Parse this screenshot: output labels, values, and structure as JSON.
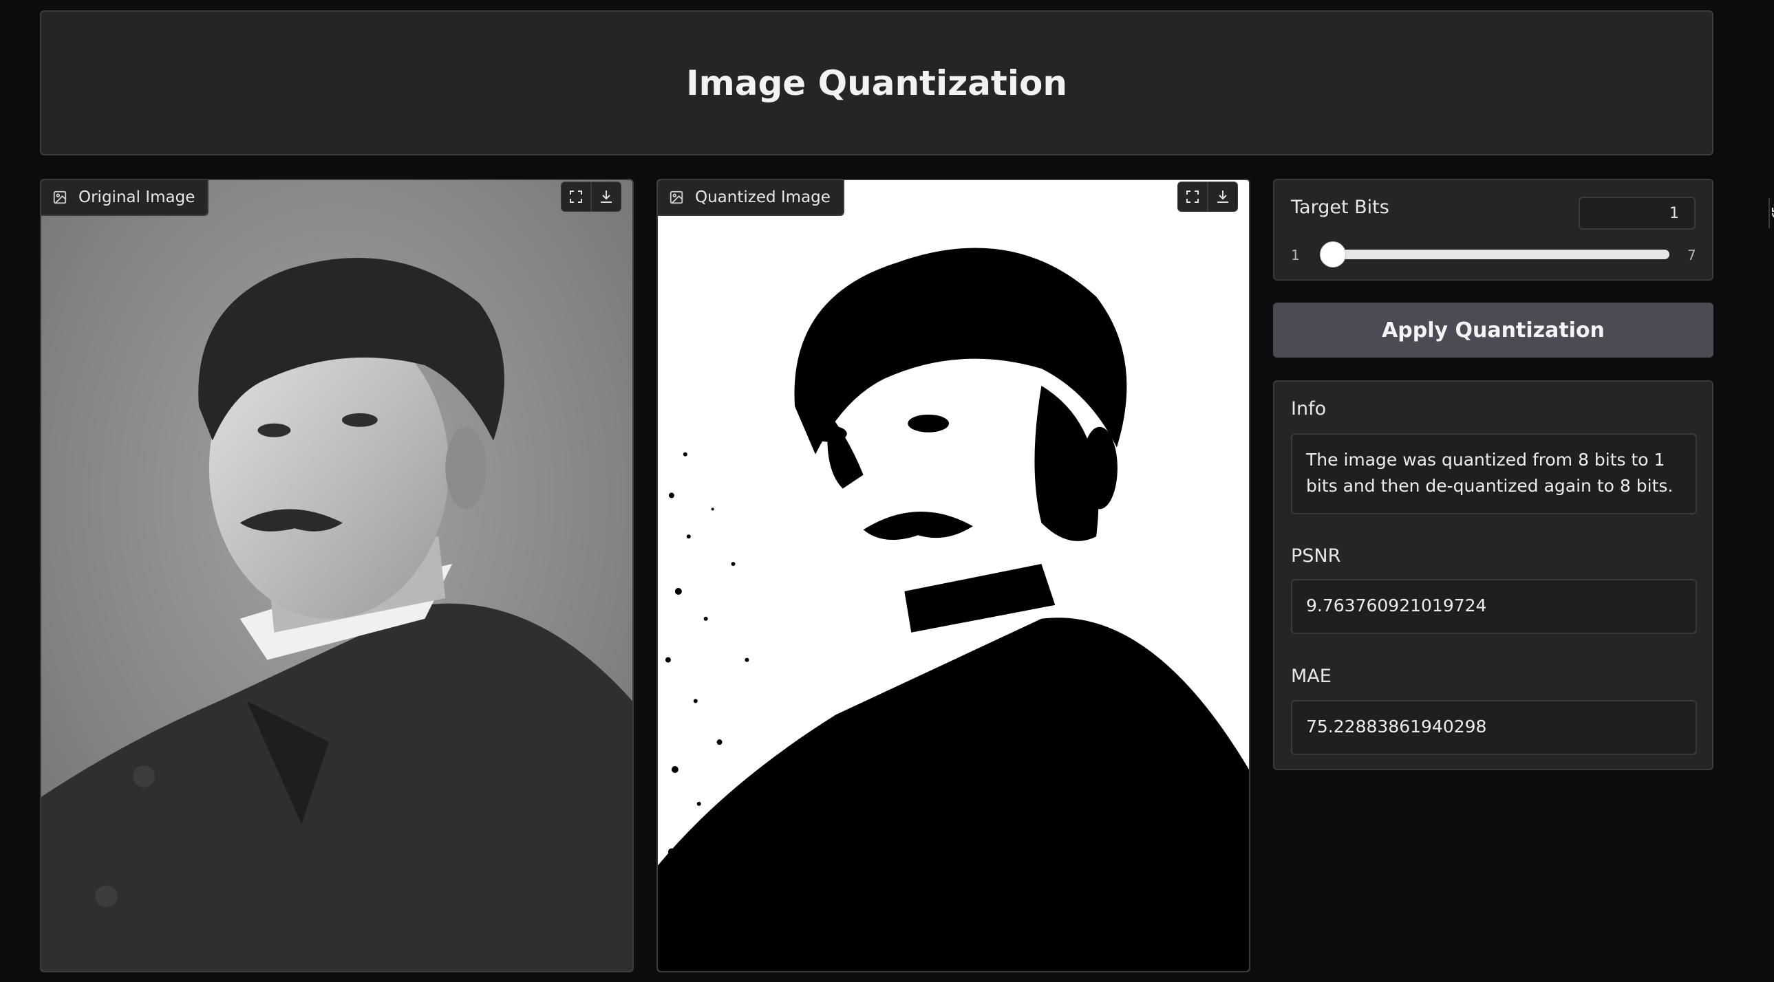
{
  "header": {
    "title": "Image Quantization"
  },
  "original": {
    "label": "Original Image"
  },
  "quantized": {
    "label": "Quantized Image"
  },
  "slider": {
    "title": "Target Bits",
    "value": "1",
    "min": "1",
    "max": "7"
  },
  "actions": {
    "apply_label": "Apply Quantization"
  },
  "info": {
    "label": "Info",
    "text": "The image was quantized from 8 bits to 1 bits and then de-quantized again to 8 bits.",
    "psnr_label": "PSNR",
    "psnr_value": "9.763760921019724",
    "mae_label": "MAE",
    "mae_value": "75.22883861940298"
  },
  "icons": {
    "image": "image-icon",
    "fullscreen": "fullscreen-icon",
    "download": "download-icon",
    "reset": "reset-icon"
  }
}
